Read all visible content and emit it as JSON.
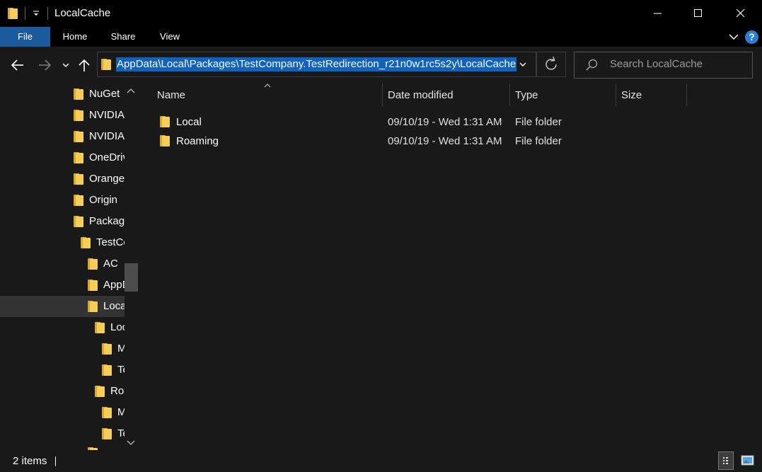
{
  "window": {
    "title": "LocalCache"
  },
  "ribbon": {
    "tabs": [
      "File",
      "Home",
      "Share",
      "View"
    ],
    "help_label": "?"
  },
  "address": {
    "path": "AppData\\Local\\Packages\\TestCompany.TestRedirection_r21n0w1rc5s2y\\LocalCache"
  },
  "search": {
    "placeholder": "Search LocalCache"
  },
  "nav_tree": [
    {
      "label": "NuGet"
    },
    {
      "label": "NVIDIA"
    },
    {
      "label": "NVIDIA"
    },
    {
      "label": "OneDrive"
    },
    {
      "label": "Orange"
    },
    {
      "label": "Origin"
    },
    {
      "label": "Packages"
    },
    {
      "label": "TestCompany"
    },
    {
      "label": "AC"
    },
    {
      "label": "AppData"
    },
    {
      "label": "LocalCache",
      "selected": true
    },
    {
      "label": "Local"
    },
    {
      "label": "M"
    },
    {
      "label": "Te"
    },
    {
      "label": "Roaming"
    },
    {
      "label": "M"
    },
    {
      "label": "Te"
    }
  ],
  "columns": {
    "name": "Name",
    "date": "Date modified",
    "type": "Type",
    "size": "Size"
  },
  "files": [
    {
      "name": "Local",
      "date": "09/10/19 - Wed 1:31 AM",
      "type": "File folder",
      "size": ""
    },
    {
      "name": "Roaming",
      "date": "09/10/19 - Wed 1:31 AM",
      "type": "File folder",
      "size": ""
    }
  ],
  "status": {
    "item_count": "2 items"
  },
  "colors": {
    "accent": "#0f62bd",
    "file_tab": "#1c5a9e",
    "background": "#191919",
    "folder": "#f4cd5a"
  }
}
